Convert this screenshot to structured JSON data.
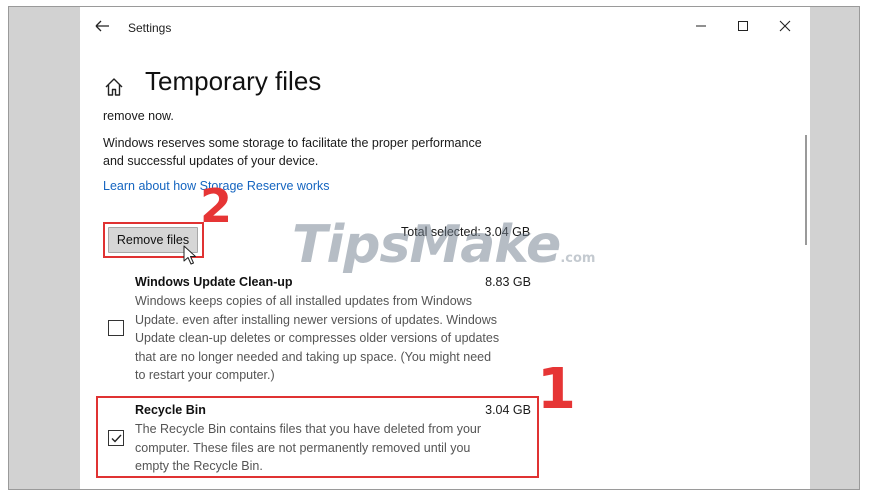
{
  "window": {
    "title": "Settings"
  },
  "page": {
    "title": "Temporary files"
  },
  "content": {
    "intro_text": "remove now.",
    "reserve_text_lines": [
      "Windows reserves some storage to facilitate the proper performance",
      "and successful updates of your device."
    ],
    "reserve_link": "Learn about how Storage Reserve works"
  },
  "actions": {
    "remove_files_label": "Remove files",
    "total_selected": "Total selected: 3.04 GB"
  },
  "items": [
    {
      "title": "Windows Update Clean-up",
      "size": "8.83 GB",
      "checked": false,
      "description_lines": [
        "Windows keeps copies of all installed updates from Windows",
        "Update. even after installing newer versions of updates. Windows",
        "Update clean-up deletes or compresses older versions of updates",
        "that are no longer needed and taking up space. (You might need",
        "to restart your computer.)"
      ]
    },
    {
      "title": "Recycle Bin",
      "size": "3.04 GB",
      "checked": true,
      "description_lines": [
        "The Recycle Bin contains files that you have deleted from your",
        "computer. These files are not permanently removed until you",
        "empty the Recycle Bin."
      ]
    }
  ],
  "annotations": {
    "step_1": "1",
    "step_2": "2"
  },
  "watermark": {
    "main": "TipsMake",
    "suffix": ".com"
  },
  "colors": {
    "highlight_red": "#e03232",
    "link_blue": "#1565c0",
    "button_gray": "#d6d6d6",
    "frame_gray": "#d2d2d2"
  },
  "icons": {
    "back": "back-arrow-icon",
    "home": "home-icon",
    "minimize": "minimize-icon",
    "maximize": "maximize-icon",
    "close": "close-icon",
    "checkmark": "checkmark-icon",
    "cursor": "mouse-pointer-icon"
  }
}
